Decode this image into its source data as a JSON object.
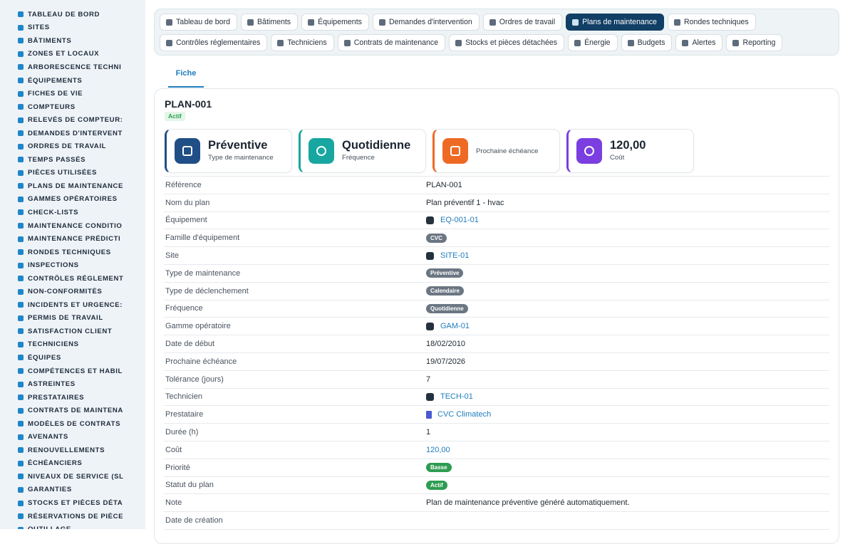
{
  "sidebar": {
    "items": [
      {
        "label": "TABLEAU DE BORD",
        "icon": "dashboard-icon"
      },
      {
        "label": "SITES",
        "icon": "map-pin-icon"
      },
      {
        "label": "BÂTIMENTS",
        "icon": "building-icon"
      },
      {
        "label": "ZONES ET LOCAUX",
        "icon": "zones-icon"
      },
      {
        "label": "ARBORESCENCE TECHNI",
        "icon": "tree-icon"
      },
      {
        "label": "ÉQUIPEMENTS",
        "icon": "gears-icon"
      },
      {
        "label": "FICHES DE VIE",
        "icon": "history-icon"
      },
      {
        "label": "COMPTEURS",
        "icon": "gauge-icon"
      },
      {
        "label": "RELEVÉS DE COMPTEUR:",
        "icon": "readings-icon"
      },
      {
        "label": "DEMANDES D'INTERVENT",
        "icon": "question-icon"
      },
      {
        "label": "ORDRES DE TRAVAIL",
        "icon": "clipboard-icon"
      },
      {
        "label": "TEMPS PASSÉS",
        "icon": "clock-icon"
      },
      {
        "label": "PIÈCES UTILISÉES",
        "icon": "parts-icon"
      },
      {
        "label": "PLANS DE MAINTENANCE",
        "icon": "calendar-icon"
      },
      {
        "label": "GAMMES OPÉRATOIRES",
        "icon": "list-icon"
      },
      {
        "label": "CHECK-LISTS",
        "icon": "checklist-icon"
      },
      {
        "label": "MAINTENANCE CONDITIO",
        "icon": "thermometer-icon"
      },
      {
        "label": "MAINTENANCE PRÉDICTI",
        "icon": "chart-icon"
      },
      {
        "label": "RONDES TECHNIQUES",
        "icon": "route-icon"
      },
      {
        "label": "INSPECTIONS",
        "icon": "search-icon"
      },
      {
        "label": "CONTRÔLES RÉGLEMENT",
        "icon": "certificate-icon"
      },
      {
        "label": "NON-CONFORMITÉS",
        "icon": "warning-circle-icon"
      },
      {
        "label": "INCIDENTS ET URGENCE:",
        "icon": "alert-triangle-icon"
      },
      {
        "label": "PERMIS DE TRAVAIL",
        "icon": "permit-icon"
      },
      {
        "label": "SATISFACTION CLIENT",
        "icon": "smile-icon"
      },
      {
        "label": "TECHNICIENS",
        "icon": "technician-icon"
      },
      {
        "label": "ÉQUIPES",
        "icon": "users-icon"
      },
      {
        "label": "COMPÉTENCES ET HABIL",
        "icon": "badge-icon"
      },
      {
        "label": "ASTREINTES",
        "icon": "phone-icon"
      },
      {
        "label": "PRESTATAIRES",
        "icon": "handshake-icon"
      },
      {
        "label": "CONTRATS DE MAINTENA",
        "icon": "contract-icon"
      },
      {
        "label": "MODÈLES DE CONTRATS",
        "icon": "template-icon"
      },
      {
        "label": "AVENANTS",
        "icon": "file-plus-icon"
      },
      {
        "label": "RENOUVELLEMENTS",
        "icon": "refresh-icon"
      },
      {
        "label": "ÉCHÉANCIERS",
        "icon": "schedule-icon"
      },
      {
        "label": "NIVEAUX DE SERVICE (SL",
        "icon": "sla-icon"
      },
      {
        "label": "GARANTIES",
        "icon": "shield-icon"
      },
      {
        "label": "STOCKS ET PIÈCES DÉTA",
        "icon": "boxes-icon"
      },
      {
        "label": "RÉSERVATIONS DE PIÈCE",
        "icon": "reservation-icon"
      },
      {
        "label": "OUTILLAGE",
        "icon": "tools-icon"
      }
    ]
  },
  "topnav": {
    "row1": [
      {
        "label": "Tableau de bord",
        "icon": "dashboard-icon",
        "active": false
      },
      {
        "label": "Bâtiments",
        "icon": "building-icon",
        "active": false
      },
      {
        "label": "Équipements",
        "icon": "gears-icon",
        "active": false
      },
      {
        "label": "Demandes d'intervention",
        "icon": "question-icon",
        "active": false
      },
      {
        "label": "Ordres de travail",
        "icon": "clipboard-icon",
        "active": false
      },
      {
        "label": "Plans de maintenance",
        "icon": "calendar-icon",
        "active": true
      },
      {
        "label": "Rondes techniques",
        "icon": "route-icon",
        "active": false
      }
    ],
    "row2": [
      {
        "label": "Contrôles réglementaires",
        "icon": "certificate-icon",
        "active": false
      },
      {
        "label": "Techniciens",
        "icon": "technician-icon",
        "active": false
      },
      {
        "label": "Contrats de maintenance",
        "icon": "contract-icon",
        "active": false
      },
      {
        "label": "Stocks et pièces détachées",
        "icon": "boxes-icon",
        "active": false
      },
      {
        "label": "Énergie",
        "icon": "bolt-icon",
        "active": false
      },
      {
        "label": "Budgets",
        "icon": "money-icon",
        "active": false
      },
      {
        "label": "Alertes",
        "icon": "bell-icon",
        "active": false
      },
      {
        "label": "Reporting",
        "icon": "pie-chart-icon",
        "active": false
      }
    ]
  },
  "tabs": {
    "fiche": "Fiche"
  },
  "record": {
    "title": "PLAN-001",
    "status": "Actif"
  },
  "stats": [
    {
      "value": "Préventive",
      "label": "Type de maintenance",
      "color": "#1f4f86",
      "icon": "calendar-icon"
    },
    {
      "value": "Quotidienne",
      "label": "Fréquence",
      "color": "#17a7a0",
      "icon": "refresh-icon"
    },
    {
      "value": "",
      "label": "Prochaine échéance",
      "color": "#ee6a24",
      "icon": "calendar-check-icon"
    },
    {
      "value": "120,00",
      "label": "Coût",
      "color": "#7b3ee0",
      "icon": "coins-icon"
    }
  ],
  "fields": [
    {
      "key": "Référence",
      "value": "PLAN-001",
      "type": "text"
    },
    {
      "key": "Nom du plan",
      "value": "Plan préventif 1 - hvac",
      "type": "text"
    },
    {
      "key": "Équipement",
      "value": "EQ-001-01",
      "type": "link"
    },
    {
      "key": "Famille d'équipement",
      "value": "CVC",
      "type": "badge-gray"
    },
    {
      "key": "Site",
      "value": "SITE-01",
      "type": "link"
    },
    {
      "key": "Type de maintenance",
      "value": "Préventive",
      "type": "badge-gray"
    },
    {
      "key": "Type de déclenchement",
      "value": "Calendaire",
      "type": "badge-gray"
    },
    {
      "key": "Fréquence",
      "value": "Quotidienne",
      "type": "badge-gray"
    },
    {
      "key": "Gamme opératoire",
      "value": "GAM-01",
      "type": "link"
    },
    {
      "key": "Date de début",
      "value": "18/02/2010",
      "type": "text"
    },
    {
      "key": "Prochaine échéance",
      "value": "19/07/2026",
      "type": "text"
    },
    {
      "key": "Tolérance (jours)",
      "value": "7",
      "type": "text"
    },
    {
      "key": "Technicien",
      "value": "TECH-01",
      "type": "link"
    },
    {
      "key": "Prestataire",
      "value": "CVC Climatech",
      "type": "link-building"
    },
    {
      "key": "Durée (h)",
      "value": "1",
      "type": "text"
    },
    {
      "key": "Coût",
      "value": "120,00",
      "type": "money"
    },
    {
      "key": "Priorité",
      "value": "Basse",
      "type": "badge-green"
    },
    {
      "key": "Statut du plan",
      "value": "Actif",
      "type": "badge-green"
    },
    {
      "key": "Note",
      "value": "Plan de maintenance préventive généré automatiquement.",
      "type": "text"
    },
    {
      "key": "Date de création",
      "value": "",
      "type": "text"
    }
  ]
}
